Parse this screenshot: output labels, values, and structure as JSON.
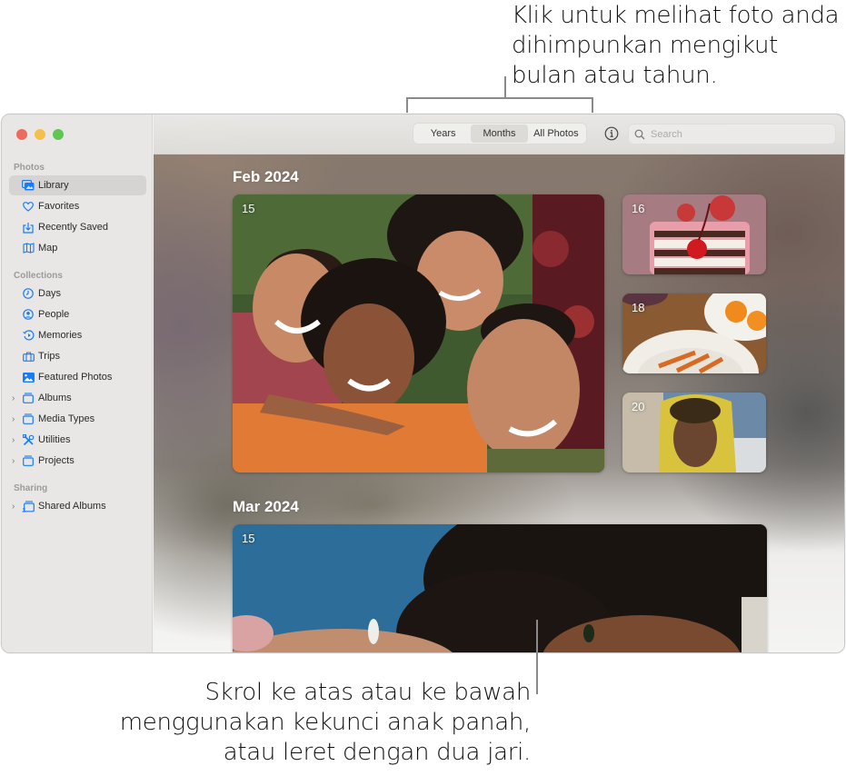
{
  "callouts": {
    "top": [
      "Klik untuk melihat foto anda",
      "dihimpunkan mengikut",
      "bulan atau tahun."
    ],
    "bottom": [
      "Skrol ke atas atau ke bawah",
      "menggunakan kekunci anak panah,",
      "atau leret dengan dua jari."
    ]
  },
  "sidebar": {
    "sections": [
      {
        "label": "Photos",
        "items": [
          {
            "label": "Library",
            "icon": "library-icon",
            "selected": true
          },
          {
            "label": "Favorites",
            "icon": "heart-icon"
          },
          {
            "label": "Recently Saved",
            "icon": "download-tray-icon"
          },
          {
            "label": "Map",
            "icon": "map-icon"
          }
        ]
      },
      {
        "label": "Collections",
        "items": [
          {
            "label": "Days",
            "icon": "clock-icon"
          },
          {
            "label": "People",
            "icon": "person-circle-icon"
          },
          {
            "label": "Memories",
            "icon": "memories-icon"
          },
          {
            "label": "Trips",
            "icon": "suitcase-icon"
          },
          {
            "label": "Featured Photos",
            "icon": "photo-icon"
          },
          {
            "label": "Albums",
            "icon": "folder-stack-icon",
            "expandable": true
          },
          {
            "label": "Media Types",
            "icon": "folder-stack-icon",
            "expandable": true
          },
          {
            "label": "Utilities",
            "icon": "tools-icon",
            "expandable": true
          },
          {
            "label": "Projects",
            "icon": "folder-stack-icon",
            "expandable": true
          }
        ]
      },
      {
        "label": "Sharing",
        "items": [
          {
            "label": "Shared Albums",
            "icon": "shared-album-icon",
            "expandable": true
          }
        ]
      }
    ]
  },
  "toolbar": {
    "view_options": [
      "Years",
      "Months",
      "All Photos"
    ],
    "selected_view": "Months",
    "info_icon": "info-icon",
    "search": {
      "placeholder": "Search",
      "value": ""
    }
  },
  "library": {
    "months": [
      {
        "title": "Feb 2024",
        "photos": [
          {
            "day": "15",
            "subject": "group selfie of four friends"
          },
          {
            "day": "16",
            "subject": "strawberry layer cake with cherry"
          },
          {
            "day": "18",
            "subject": "plate of roasted carrots and oranges"
          },
          {
            "day": "20",
            "subject": "person in yellow hood at beach"
          }
        ]
      },
      {
        "title": "Mar 2024",
        "photos": [
          {
            "day": "15",
            "subject": "two people lying with curly hair"
          }
        ]
      }
    ]
  },
  "colors": {
    "accent": "#1a7cf5",
    "close": "#ed6a5e",
    "minimize": "#f5bf4f",
    "maximize": "#61c554"
  }
}
